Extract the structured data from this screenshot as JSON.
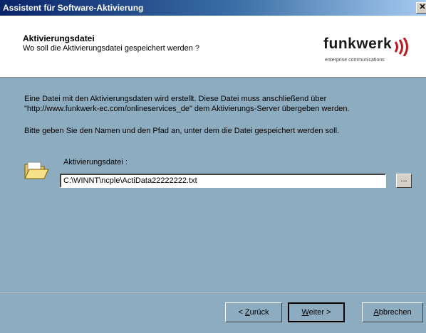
{
  "window": {
    "title": "Assistent für Software-Aktivierung",
    "close_label": "✕"
  },
  "header": {
    "title": "Aktivierungsdatei",
    "subtitle": "Wo soll die Aktivierungsdatei gespeichert werden ?",
    "logo_brand": "funkwerk",
    "logo_sub": "enterprise communications",
    "logo_color": "#c0161e"
  },
  "body": {
    "paragraph_line1": "Eine Datei mit den Aktivierungsdaten wird erstellt. Diese Datei muss anschließend über",
    "paragraph_line2": "\"http://www.funkwerk-ec.com/onlineservices_de\" dem Aktivierungs-Server übergeben werden.",
    "instruction": "Bitte geben Sie den Namen und den Pfad an, unter dem die Datei gespeichert werden soll.",
    "field_label": "Aktivierungsdatei :",
    "field_value": "C:\\WINNT\\ncple\\ActiData22222222.txt",
    "browse_label": "..."
  },
  "buttons": {
    "back": {
      "prefix": "< ",
      "mnemonic": "Z",
      "rest": "urück"
    },
    "next": {
      "mnemonic": "W",
      "rest": "eiter >"
    },
    "cancel": {
      "mnemonic": "A",
      "rest": "bbrechen"
    }
  }
}
